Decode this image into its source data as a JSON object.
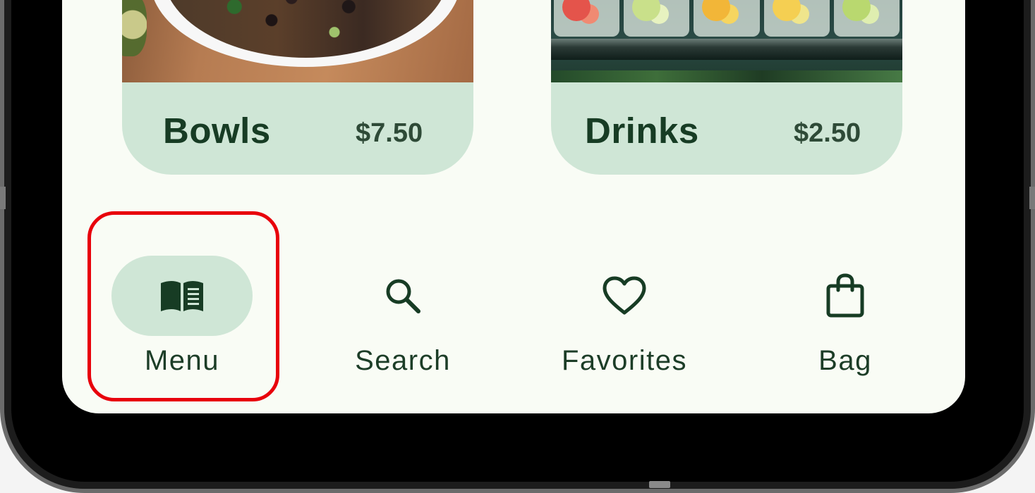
{
  "cards": [
    {
      "title": "Bowls",
      "price": "$7.50",
      "image": "bowl-image"
    },
    {
      "title": "Drinks",
      "price": "$2.50",
      "image": "drinks-image"
    }
  ],
  "nav": {
    "items": [
      {
        "label": "Menu",
        "icon": "menu-book-icon",
        "selected": true
      },
      {
        "label": "Search",
        "icon": "search-icon",
        "selected": false
      },
      {
        "label": "Favorites",
        "icon": "heart-icon",
        "selected": false
      },
      {
        "label": "Bag",
        "icon": "shopping-bag-icon",
        "selected": false
      }
    ]
  },
  "colors": {
    "screen_bg": "#f9fcf5",
    "card_bg": "#cfe6d6",
    "text_dark": "#173c24",
    "highlight": "#e8000b"
  }
}
